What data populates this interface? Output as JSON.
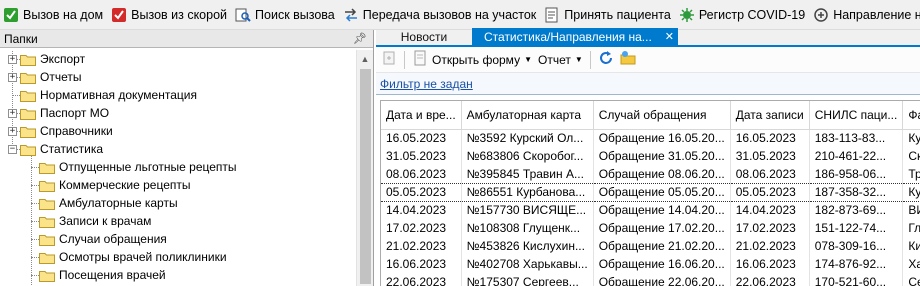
{
  "toolbar": {
    "items": [
      {
        "label": "Вызов на дом",
        "icon": "check-green-icon"
      },
      {
        "label": "Вызов из скорой",
        "icon": "check-red-icon"
      },
      {
        "label": "Поиск вызова",
        "icon": "search-call-icon"
      },
      {
        "label": "Передача вызовов на участок",
        "icon": "transfer-icon"
      },
      {
        "label": "Принять пациента",
        "icon": "accept-patient-icon"
      },
      {
        "label": "Регистр COVID-19",
        "icon": "virus-icon"
      },
      {
        "label": "Направление на МСЭ",
        "icon": "referral-icon"
      }
    ]
  },
  "left_panel": {
    "title": "Папки",
    "pin_icon": "pin-icon",
    "tree": [
      {
        "label": "Экспорт",
        "level": 0,
        "expander": "+"
      },
      {
        "label": "Отчеты",
        "level": 0,
        "expander": "+"
      },
      {
        "label": "Нормативная документация",
        "level": 0,
        "expander": ""
      },
      {
        "label": "Паспорт МО",
        "level": 0,
        "expander": "+"
      },
      {
        "label": "Справочники",
        "level": 0,
        "expander": "+"
      },
      {
        "label": "Статистика",
        "level": 0,
        "expander": "−"
      },
      {
        "label": "Отпущенные льготные рецепты",
        "level": 1,
        "expander": ""
      },
      {
        "label": "Коммерческие рецепты",
        "level": 1,
        "expander": ""
      },
      {
        "label": "Амбулаторные карты",
        "level": 1,
        "expander": ""
      },
      {
        "label": "Записи к врачам",
        "level": 1,
        "expander": ""
      },
      {
        "label": "Случаи обращения",
        "level": 1,
        "expander": ""
      },
      {
        "label": "Осмотры врачей поликлиники",
        "level": 1,
        "expander": ""
      },
      {
        "label": "Посещения врачей",
        "level": 1,
        "expander": ""
      }
    ]
  },
  "tabs": [
    {
      "label": "Новости",
      "active": false
    },
    {
      "label": "Статистика/Направления на...",
      "active": true,
      "close": "✕"
    }
  ],
  "subtoolbar": {
    "open_form": "Открыть форму",
    "report": "Отчет"
  },
  "filter_link": "Фильтр не задан",
  "grid": {
    "columns": [
      "Дата и вре...",
      "Амбулаторная карта",
      "Случай обращения",
      "Дата записи",
      "СНИЛС паци...",
      "Фами"
    ],
    "rows": [
      [
        "16.05.2023",
        "№3592 Курский Ол...",
        "Обращение 16.05.20...",
        "16.05.2023",
        "183-113-83...",
        "Курс"
      ],
      [
        "31.05.2023",
        "№683806 Скоробог...",
        "Обращение 31.05.20...",
        "31.05.2023",
        "210-461-22...",
        "Скор"
      ],
      [
        "08.06.2023",
        "№395845 Травин А...",
        "Обращение 08.06.20...",
        "08.06.2023",
        "186-958-06...",
        "Трави"
      ],
      [
        "05.05.2023",
        "№86551 Курбанова...",
        "Обращение 05.05.20...",
        "05.05.2023",
        "187-358-32...",
        "Курб"
      ],
      [
        "14.04.2023",
        "№157730 ВИСЯЩЕ...",
        "Обращение 14.04.20...",
        "14.04.2023",
        "182-873-69...",
        "ВИСЯ"
      ],
      [
        "17.02.2023",
        "№108308 Глущенк...",
        "Обращение 17.02.20...",
        "17.02.2023",
        "151-122-74...",
        "Глущ"
      ],
      [
        "21.02.2023",
        "№453826 Кислухин...",
        "Обращение 21.02.20...",
        "21.02.2023",
        "078-309-16...",
        "Кислу"
      ],
      [
        "16.06.2023",
        "№402708 Харькавы...",
        "Обращение 16.06.20...",
        "16.06.2023",
        "174-876-92...",
        "Харь"
      ],
      [
        "22.06.2023",
        "№175307 Сергеев...",
        "Обращение 22.06.20...",
        "22.06.2023",
        "170-521-60...",
        "Серг"
      ]
    ],
    "selected_row": 3
  }
}
